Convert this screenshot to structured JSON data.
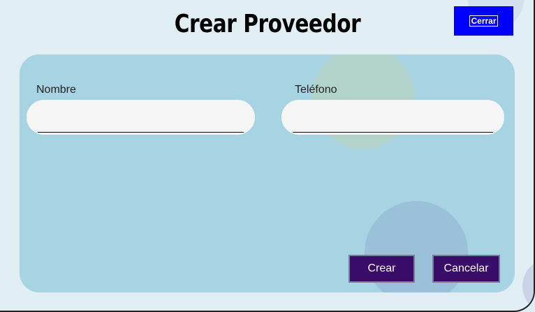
{
  "dialog": {
    "title": "Crear Proveedor",
    "close_label": "Cerrar"
  },
  "form": {
    "name": {
      "label": "Nombre",
      "value": "",
      "placeholder": ""
    },
    "phone": {
      "label": "Teléfono",
      "value": "",
      "placeholder": ""
    }
  },
  "actions": {
    "create_label": "Crear",
    "cancel_label": "Cancelar"
  },
  "colors": {
    "background": "#e1eff5",
    "panel": "#a7d4e3",
    "close_button": "#0000ff",
    "action_button": "#3a0c69"
  }
}
